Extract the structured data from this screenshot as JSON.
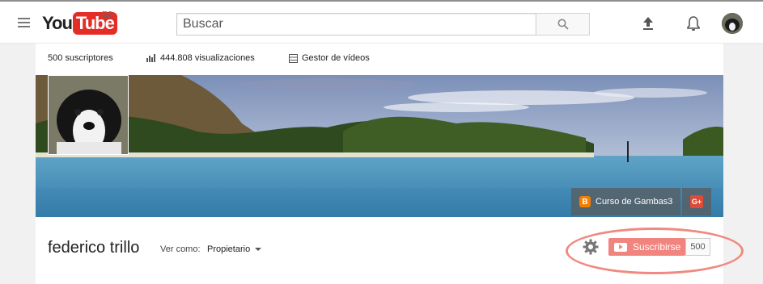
{
  "header": {
    "logo_you": "You",
    "logo_tube": "Tube",
    "country_code": "ES",
    "search_placeholder": "Buscar",
    "search_value": "",
    "menu_icon": "hamburger-icon",
    "search_icon": "magnifier-icon",
    "upload_icon": "upload-arrow-icon",
    "notifications_icon": "bell-icon"
  },
  "stats": {
    "subscribers": "500 suscriptores",
    "views": "444.808 visualizaciones",
    "video_manager": "Gestor de vídeos"
  },
  "banner": {
    "links": [
      {
        "label": "Curso de Gambas3",
        "icon": "blogger-icon"
      },
      {
        "label": "",
        "icon": "google-plus-icon",
        "text": "G+"
      }
    ]
  },
  "channel": {
    "name": "federico trillo",
    "view_as_label": "Ver como:",
    "view_as_value": "Propietario",
    "subscribe_label": "Suscribirse",
    "subscriber_count": "500"
  },
  "colors": {
    "brand_red": "#e52d27",
    "subscribe_red": "#e62117",
    "highlight": "#f08a80",
    "blogger": "#f57d00",
    "gplus": "#dd4b39"
  }
}
